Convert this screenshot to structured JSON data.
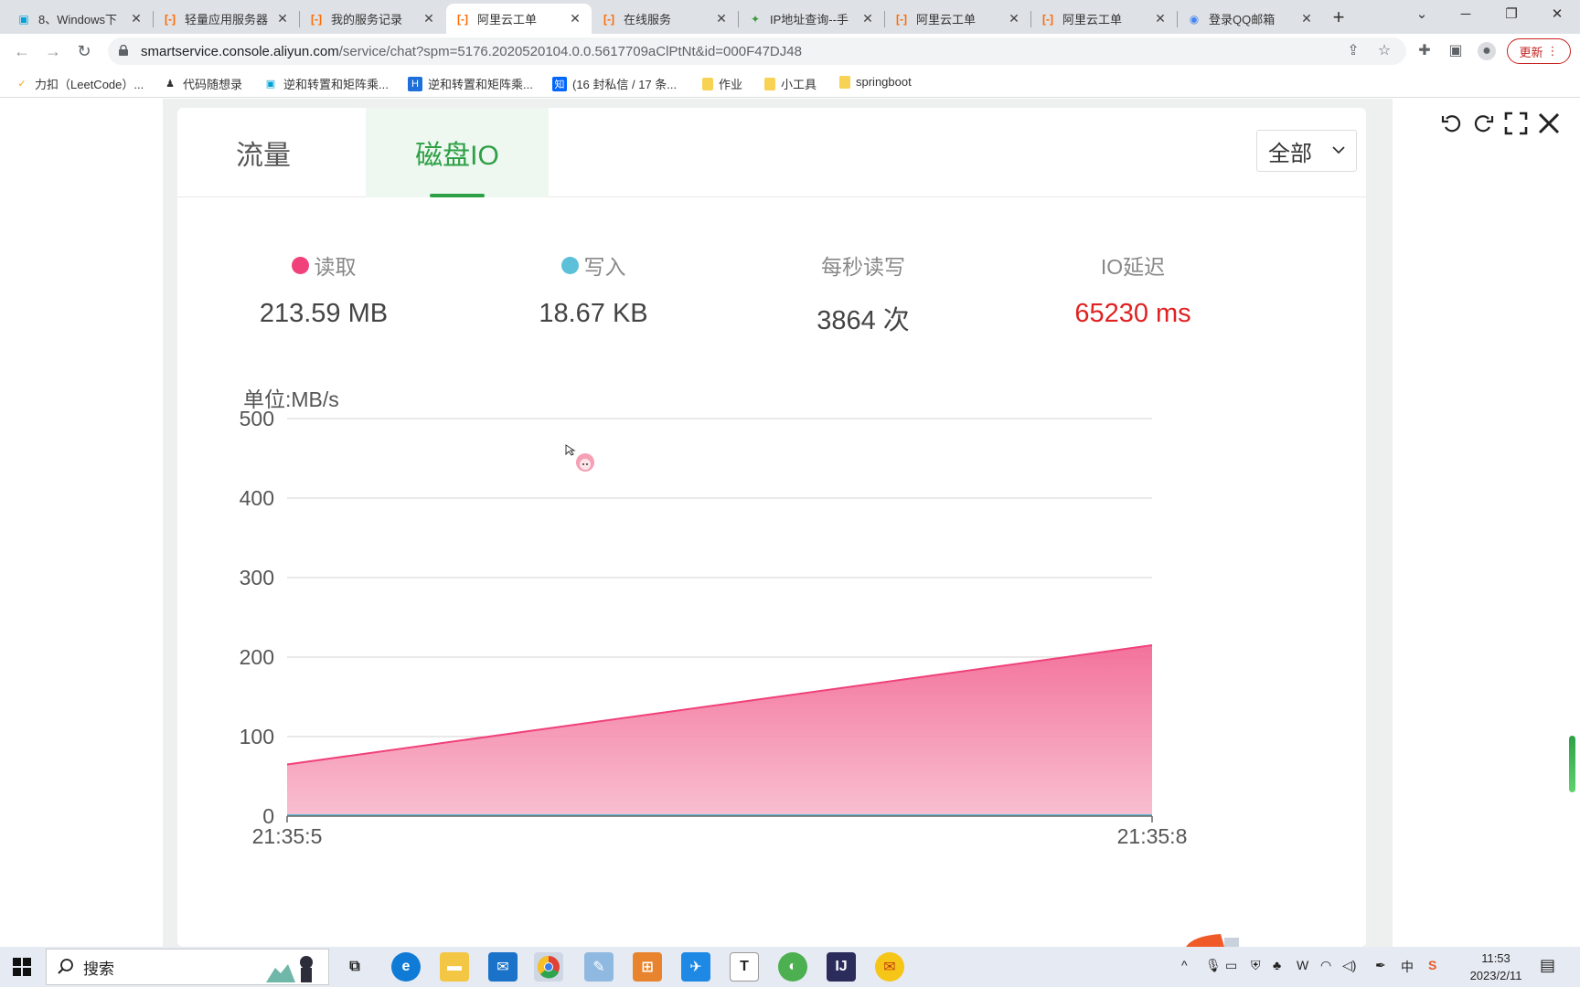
{
  "browser": {
    "tabs": [
      {
        "title": "8、Windows下",
        "favicon": "bilibili-icon",
        "color": "#00a1d6",
        "active": false
      },
      {
        "title": "轻量应用服务器",
        "favicon": "aliyun-icon",
        "color": "#ff6a00",
        "active": false
      },
      {
        "title": "我的服务记录",
        "favicon": "aliyun-icon",
        "color": "#ff6a00",
        "active": false
      },
      {
        "title": "阿里云工单",
        "favicon": "aliyun-icon",
        "color": "#ff6a00",
        "active": true
      },
      {
        "title": "在线服务",
        "favicon": "aliyun-icon",
        "color": "#ff6a00",
        "active": false
      },
      {
        "title": "IP地址查询--手",
        "favicon": "ip-lookup-icon",
        "color": "#3a9b3a",
        "active": false
      },
      {
        "title": "阿里云工单",
        "favicon": "aliyun-icon",
        "color": "#ff6a00",
        "active": false
      },
      {
        "title": "阿里云工单",
        "favicon": "aliyun-icon",
        "color": "#ff6a00",
        "active": false
      },
      {
        "title": "登录QQ邮箱",
        "favicon": "chrome-icon",
        "color": "#4285f4",
        "active": false
      }
    ],
    "url_host": "smartservice.console.aliyun.com",
    "url_path": "/service/chat?spm=5176.2020520104.0.0.5617709aClPtNt&id=000F47DJ48",
    "update_label": "更新",
    "bookmarks": [
      {
        "label": "力扣（LeetCode）...",
        "icon": "leetcode-icon",
        "color": "#f89f1b"
      },
      {
        "label": "代码随想录",
        "icon": "person-icon",
        "color": "#333333"
      },
      {
        "label": "逆和转置和矩阵乘...",
        "icon": "bilibili-icon",
        "color": "#00a1d6"
      },
      {
        "label": "逆和转置和矩阵乘...",
        "icon": "h-icon",
        "color": "#1e6fd9"
      },
      {
        "label": "(16 封私信 / 17 条...",
        "icon": "zhihu-icon",
        "color": "#0066ff"
      },
      {
        "label": "作业",
        "icon": "folder-icon",
        "color": "#f7d254"
      },
      {
        "label": "小工具",
        "icon": "folder-icon",
        "color": "#f7d254"
      },
      {
        "label": "springboot",
        "icon": "folder-icon",
        "color": "#f7d254"
      }
    ]
  },
  "panel": {
    "tabs": [
      {
        "label": "流量",
        "active": false
      },
      {
        "label": "磁盘IO",
        "active": true
      }
    ],
    "range_select": "全部",
    "stats": [
      {
        "label": "读取",
        "value": "213.59 MB",
        "dot_color": "#f0417a",
        "value_color": "#444444"
      },
      {
        "label": "写入",
        "value": "18.67 KB",
        "dot_color": "#5bc0d8",
        "value_color": "#444444"
      },
      {
        "label": "每秒读写",
        "value": "3864 次",
        "dot_color": "",
        "value_color": "#444444"
      },
      {
        "label": "IO延迟",
        "value": "65230 ms",
        "dot_color": "",
        "value_color": "#e02222"
      }
    ],
    "unit_label": "单位:MB/s"
  },
  "chart_data": {
    "type": "area",
    "x": [
      "21:35:5",
      "21:35:8"
    ],
    "series": [
      {
        "values": [
          65,
          215
        ],
        "color": "#f0417a"
      },
      {
        "values": [
          0,
          0
        ],
        "color": "#5bc0d8"
      }
    ],
    "yticks": [
      0,
      100,
      200,
      300,
      400,
      500
    ],
    "ylim": [
      0,
      500
    ],
    "grid": true,
    "xlabel": "",
    "ylabel": "单位:MB/s"
  },
  "taskbar": {
    "search_placeholder": "搜索",
    "clock_time": "11:53",
    "clock_date": "2023/2/11",
    "ime_label": "中"
  }
}
